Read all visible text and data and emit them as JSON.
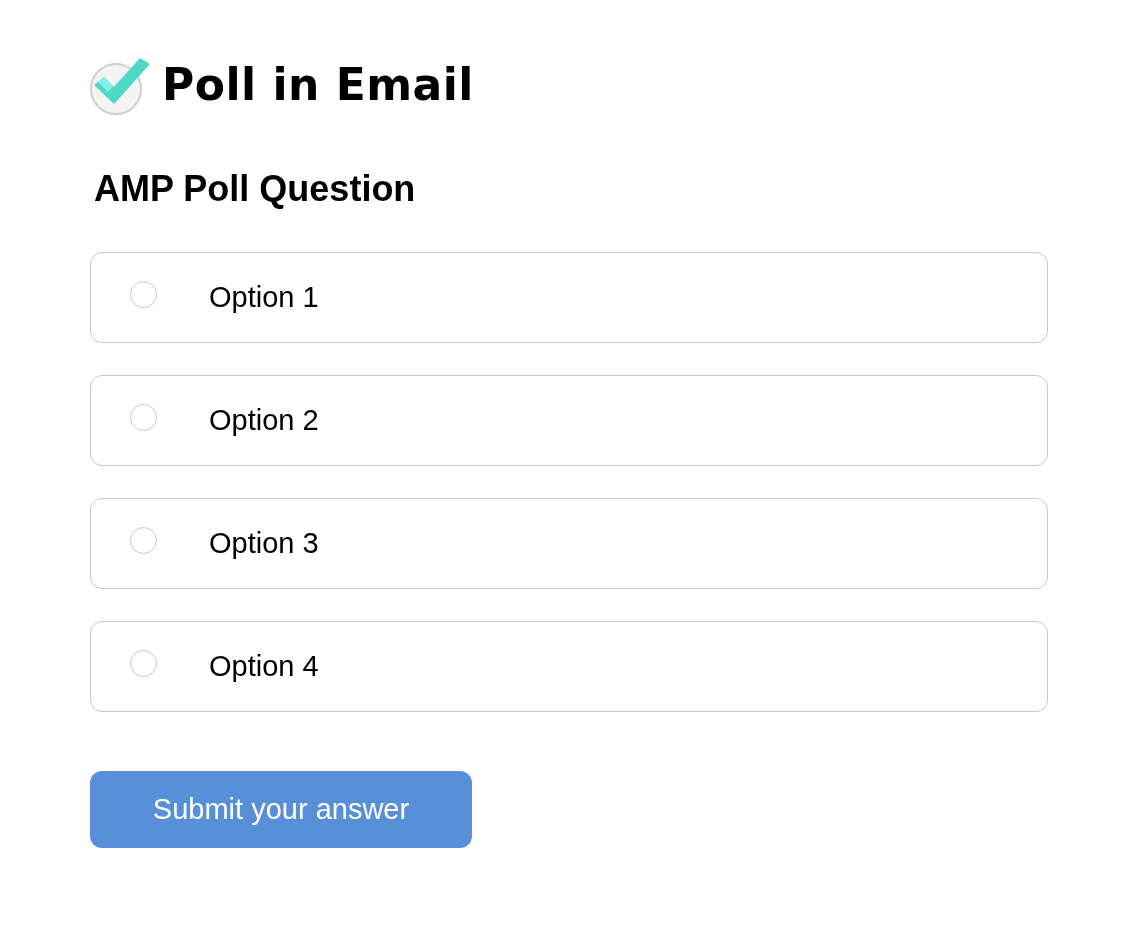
{
  "header": {
    "title": "Poll in Email"
  },
  "question": "AMP Poll Question",
  "options": [
    {
      "label": "Option 1",
      "selected": false
    },
    {
      "label": "Option 2",
      "selected": false
    },
    {
      "label": "Option 3",
      "selected": false
    },
    {
      "label": "Option 4",
      "selected": false
    }
  ],
  "submit_button": "Submit your answer"
}
